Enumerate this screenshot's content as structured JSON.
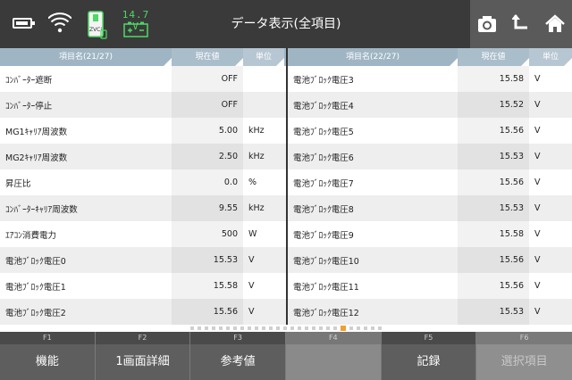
{
  "header": {
    "title": "データ表示(全項目)",
    "voltage": "14.7 V",
    "device_label": "ZVCi",
    "icons": [
      "battery-icon",
      "wifi-icon",
      "zvci-icon",
      "car-battery-icon",
      "camera-icon",
      "upload-icon",
      "home-icon"
    ]
  },
  "left_table": {
    "headers": {
      "name": "項目名(21/27)",
      "value": "現在値",
      "unit": "単位"
    },
    "rows": [
      {
        "name": "ｺﾝﾊﾞｰﾀｰ遮断",
        "value": "OFF",
        "unit": ""
      },
      {
        "name": "ｺﾝﾊﾞｰﾀｰ停止",
        "value": "OFF",
        "unit": ""
      },
      {
        "name": "MG1ｷｬﾘｱ周波数",
        "value": "5.00",
        "unit": "kHz"
      },
      {
        "name": "MG2ｷｬﾘｱ周波数",
        "value": "2.50",
        "unit": "kHz"
      },
      {
        "name": "昇圧比",
        "value": "0.0",
        "unit": "%"
      },
      {
        "name": "ｺﾝﾊﾞｰﾀｰｷｬﾘｱ周波数",
        "value": "9.55",
        "unit": "kHz"
      },
      {
        "name": "ｴｱｺﾝ消費電力",
        "value": "500",
        "unit": "W"
      },
      {
        "name": "電池ﾌﾞﾛｯｸ電圧0",
        "value": "15.53",
        "unit": "V"
      },
      {
        "name": "電池ﾌﾞﾛｯｸ電圧1",
        "value": "15.58",
        "unit": "V"
      },
      {
        "name": "電池ﾌﾞﾛｯｸ電圧2",
        "value": "15.56",
        "unit": "V"
      }
    ]
  },
  "right_table": {
    "headers": {
      "name": "項目名(22/27)",
      "value": "現在値",
      "unit": "単位"
    },
    "rows": [
      {
        "name": "電池ﾌﾞﾛｯｸ電圧3",
        "value": "15.58",
        "unit": "V"
      },
      {
        "name": "電池ﾌﾞﾛｯｸ電圧4",
        "value": "15.52",
        "unit": "V"
      },
      {
        "name": "電池ﾌﾞﾛｯｸ電圧5",
        "value": "15.56",
        "unit": "V"
      },
      {
        "name": "電池ﾌﾞﾛｯｸ電圧6",
        "value": "15.53",
        "unit": "V"
      },
      {
        "name": "電池ﾌﾞﾛｯｸ電圧7",
        "value": "15.56",
        "unit": "V"
      },
      {
        "name": "電池ﾌﾞﾛｯｸ電圧8",
        "value": "15.53",
        "unit": "V"
      },
      {
        "name": "電池ﾌﾞﾛｯｸ電圧9",
        "value": "15.58",
        "unit": "V"
      },
      {
        "name": "電池ﾌﾞﾛｯｸ電圧10",
        "value": "15.56",
        "unit": "V"
      },
      {
        "name": "電池ﾌﾞﾛｯｸ電圧11",
        "value": "15.56",
        "unit": "V"
      },
      {
        "name": "電池ﾌﾞﾛｯｸ電圧12",
        "value": "15.53",
        "unit": "V"
      }
    ]
  },
  "pagination": {
    "total": 27,
    "active": 22
  },
  "function_bar": [
    {
      "key": "F1",
      "label": "機能",
      "state": "enabled"
    },
    {
      "key": "F2",
      "label": "1画面詳細",
      "state": "enabled"
    },
    {
      "key": "F3",
      "label": "参考値",
      "state": "enabled"
    },
    {
      "key": "F4",
      "label": "",
      "state": "empty"
    },
    {
      "key": "F5",
      "label": "記録",
      "state": "enabled"
    },
    {
      "key": "F6",
      "label": "選択項目",
      "state": "disabled"
    }
  ],
  "colors": {
    "header_bg": "#3a3a3a",
    "table_header_bg": "#9fb5c4",
    "active_dot": "#f0a030",
    "voltage_text": "#4cd964"
  }
}
